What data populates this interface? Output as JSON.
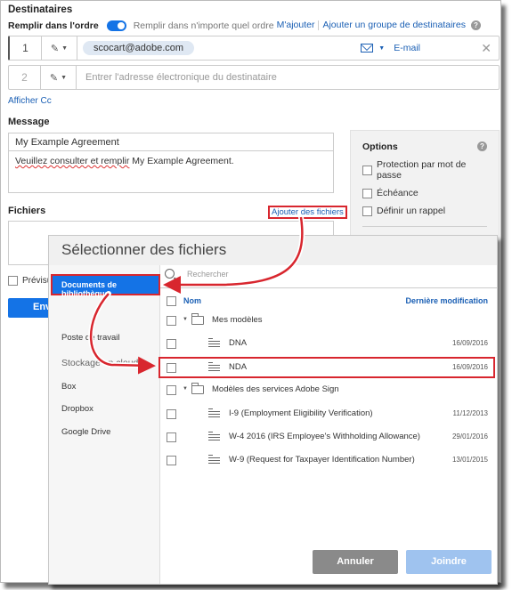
{
  "form": {
    "recipients_label": "Destinataires",
    "order_label": "Remplir dans l'ordre",
    "any_order_label": "Remplir dans n'importe quel ordre",
    "add_me": "M'ajouter",
    "add_group": "Ajouter un groupe de destinataires",
    "recipients": [
      {
        "index": "1",
        "email": "scocart@adobe.com",
        "type": "E-mail"
      },
      {
        "index": "2",
        "placeholder": "Entrer l'adresse électronique du destinataire"
      }
    ],
    "show_cc": "Afficher Cc",
    "message_label": "Message",
    "message_title": "My Example Agreement",
    "message_body_underlined": "Veuillez consulter et remplir",
    "message_body_rest": " My Example Agreement.",
    "options": {
      "title": "Options",
      "items": [
        "Protection par mot de passe",
        "Échéance",
        "Définir un rappel"
      ]
    },
    "files_label": "Fichiers",
    "add_files": "Ajouter des fichiers",
    "preview_label": "Prévisua",
    "send_label": "Env"
  },
  "dialog": {
    "title": "Sélectionner des fichiers",
    "sidebar": {
      "library": "Documents de bibliothèque",
      "workstation": "Poste de travail",
      "cloud_section": "Stockage en cloud",
      "cloud": [
        "Box",
        "Dropbox",
        "Google Drive"
      ]
    },
    "search_placeholder": "Rechercher",
    "columns": {
      "name": "Nom",
      "modified": "Dernière modification"
    },
    "rows": [
      {
        "kind": "folder",
        "name": "Mes modèles",
        "date": ""
      },
      {
        "kind": "file",
        "name": "DNA",
        "date": "16/09/2016"
      },
      {
        "kind": "file",
        "name": "NDA",
        "date": "16/09/2016"
      },
      {
        "kind": "folder",
        "name": "Modèles des services Adobe Sign",
        "date": ""
      },
      {
        "kind": "file",
        "name": "I-9 (Employment Eligibility Verification)",
        "date": "11/12/2013"
      },
      {
        "kind": "file",
        "name": "W-4 2016 (IRS Employee's Withholding Allowance)",
        "date": "29/01/2016"
      },
      {
        "kind": "file",
        "name": "W-9 (Request for Taxpayer Identification Number)",
        "date": "13/01/2015"
      }
    ],
    "cancel": "Annuler",
    "join": "Joindre"
  },
  "colors": {
    "accent": "#1473e6",
    "highlight": "#d8262e",
    "link": "#1a5fb4"
  }
}
